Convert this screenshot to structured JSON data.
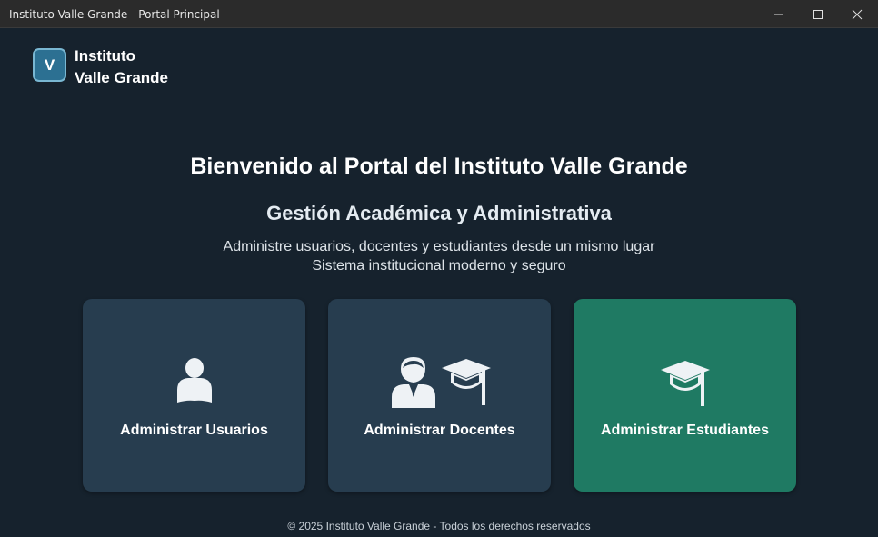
{
  "window": {
    "title": "Instituto Valle Grande - Portal Principal",
    "controls": [
      "minimize-icon",
      "maximize-icon",
      "close-icon"
    ]
  },
  "brand": {
    "logo_letter": "V",
    "name_line1": "Instituto",
    "name_line2": "Valle Grande"
  },
  "hero": {
    "title": "Bienvenido al Portal del Instituto Valle Grande",
    "subtitle": "Gestión Académica y Administrativa",
    "description_line1": "Administre usuarios, docentes y estudiantes desde un mismo lugar",
    "description_line2": "Sistema institucional moderno y seguro"
  },
  "cards": [
    {
      "label": "Administrar Usuarios",
      "icon": "user-icon",
      "color": "#273d4f"
    },
    {
      "label": "Administrar Docentes",
      "icon": "teacher-icon",
      "color": "#273d4f"
    },
    {
      "label": "Administrar Estudiantes",
      "icon": "graduation-cap-icon",
      "color": "#1f7a63"
    }
  ],
  "footer": {
    "text": "© 2025 Instituto Valle Grande - Todos los derechos reservados"
  },
  "colors": {
    "background": "#16222d",
    "card": "#273d4f",
    "card_accent": "#1f7a63",
    "logo": "#2c7092"
  }
}
